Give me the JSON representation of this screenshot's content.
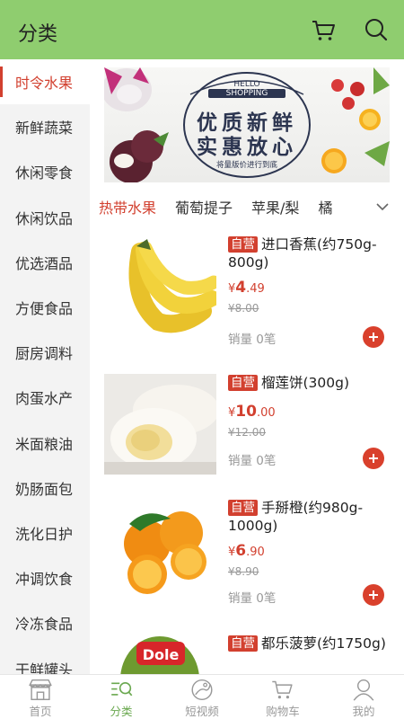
{
  "header": {
    "title": "分类"
  },
  "sidebar": {
    "items": [
      {
        "label": "时令水果"
      },
      {
        "label": "新鲜蔬菜"
      },
      {
        "label": "休闲零食"
      },
      {
        "label": "休闲饮品"
      },
      {
        "label": "优选酒品"
      },
      {
        "label": "方便食品"
      },
      {
        "label": "厨房调料"
      },
      {
        "label": "肉蛋水产"
      },
      {
        "label": "米面粮油"
      },
      {
        "label": "奶肠面包"
      },
      {
        "label": "洗化日护"
      },
      {
        "label": "冲调饮食"
      },
      {
        "label": "冷冻食品"
      },
      {
        "label": "干鲜罐头"
      }
    ]
  },
  "banner": {
    "line1": "HELLO",
    "line2": "SHOPPING",
    "headline1": "优质新鲜",
    "headline2": "实惠放心",
    "footer": "将量版价进行到底"
  },
  "subtabs": {
    "items": [
      {
        "label": "热带水果"
      },
      {
        "label": "葡萄提子"
      },
      {
        "label": "苹果/梨"
      },
      {
        "label": "橘"
      }
    ]
  },
  "products": [
    {
      "tag": "自营",
      "title": "进口香蕉(约750g-800g)",
      "currency": "¥",
      "price_int": "4",
      "price_dec": ".49",
      "old_price": "¥8.00",
      "sales": "销量 0笔"
    },
    {
      "tag": "自营",
      "title": "榴莲饼(300g)",
      "currency": "¥",
      "price_int": "10",
      "price_dec": ".00",
      "old_price": "¥12.00",
      "sales": "销量 0笔"
    },
    {
      "tag": "自营",
      "title": "手掰橙(约980g-1000g)",
      "currency": "¥",
      "price_int": "6",
      "price_dec": ".90",
      "old_price": "¥8.90",
      "sales": "销量 0笔"
    },
    {
      "tag": "自营",
      "title": "都乐菠萝(约1750g)",
      "brand": "Dole"
    }
  ],
  "bottom_nav": {
    "items": [
      {
        "label": "首页"
      },
      {
        "label": "分类"
      },
      {
        "label": "短视频"
      },
      {
        "label": "购物车"
      },
      {
        "label": "我的"
      }
    ]
  },
  "colors": {
    "header": "#8fcd6f",
    "accent": "#d2402f",
    "active_tab": "#6aa84f"
  }
}
